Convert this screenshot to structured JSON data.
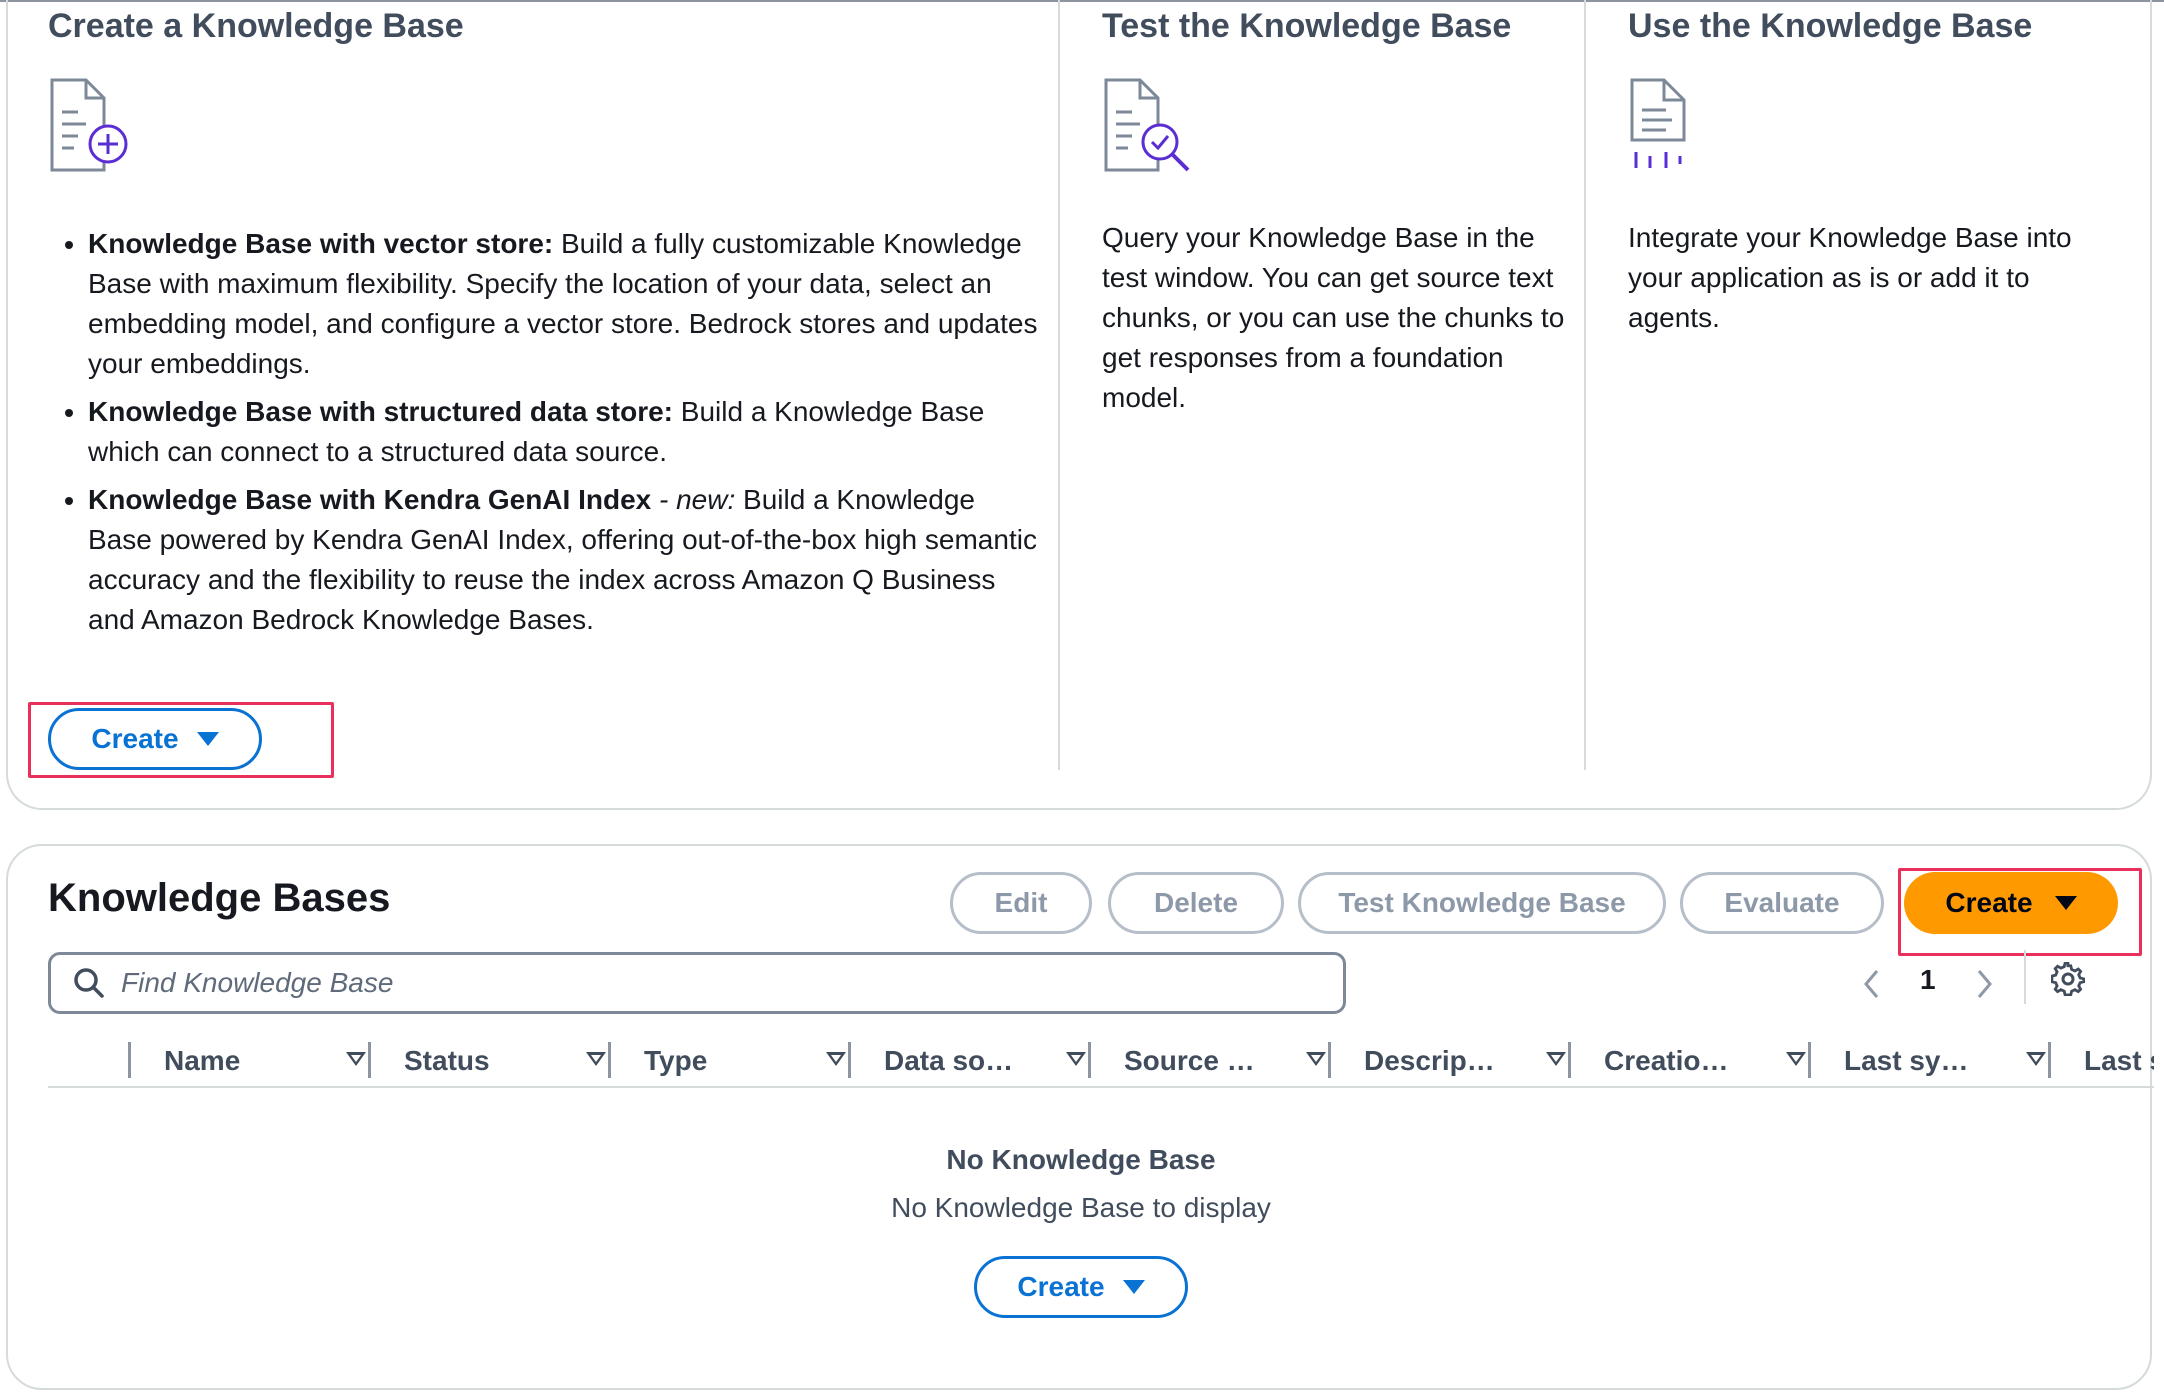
{
  "columns": [
    {
      "title": "Create a Knowledge Base",
      "icon": "document-add-icon",
      "bullets": [
        {
          "bold": "Knowledge Base with vector store:",
          "italic": "",
          "text": " Build a fully customizable Knowledge Base with maximum flexibility. Specify the location of your data, select an embedding model, and configure a vector store. Bedrock stores and updates your embeddings."
        },
        {
          "bold": "Knowledge Base with structured data store:",
          "italic": "",
          "text": " Build a Knowledge Base which can connect to a structured data source."
        },
        {
          "bold": "Knowledge Base with Kendra GenAI Index",
          "italic": " - new:",
          "text": " Build a Knowledge Base powered by Kendra GenAI Index, offering out-of-the-box high semantic accuracy and the flexibility to reuse the index across Amazon Q Business and Amazon Bedrock Knowledge Bases."
        }
      ],
      "button_label": "Create"
    },
    {
      "title": "Test the Knowledge Base",
      "icon": "document-search-icon",
      "text": "Query your Knowledge Base in the test window. You can get source text chunks, or you can use the chunks to get responses from a foundation model."
    },
    {
      "title": "Use the Knowledge Base",
      "icon": "document-integrate-icon",
      "text": "Integrate your Knowledge Base into your application as is or add it to agents."
    }
  ],
  "table": {
    "title": "Knowledge Bases",
    "actions": {
      "edit": "Edit",
      "delete": "Delete",
      "test": "Test Knowledge Base",
      "evaluate": "Evaluate",
      "create": "Create"
    },
    "search_placeholder": "Find Knowledge Base",
    "page": "1",
    "headers": [
      "Name",
      "Status",
      "Type",
      "Data so…",
      "Source …",
      "Descrip…",
      "Creatio…",
      "Last sy…",
      "Last s"
    ],
    "empty_title": "No Knowledge Base",
    "empty_subtitle": "No Knowledge Base to display",
    "empty_button": "Create"
  },
  "colors": {
    "accent_blue": "#0972d3",
    "primary_orange": "#ff9900",
    "highlight_red": "#e8305a",
    "icon_purple": "#5a2ed2"
  }
}
